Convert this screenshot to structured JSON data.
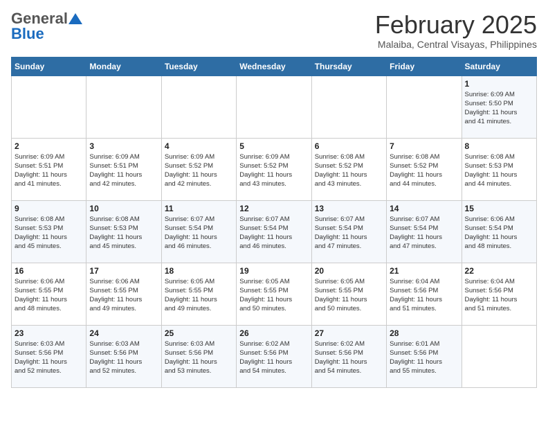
{
  "header": {
    "logo_general": "General",
    "logo_blue": "Blue",
    "month_year": "February 2025",
    "location": "Malaiba, Central Visayas, Philippines"
  },
  "weekdays": [
    "Sunday",
    "Monday",
    "Tuesday",
    "Wednesday",
    "Thursday",
    "Friday",
    "Saturday"
  ],
  "weeks": [
    [
      {
        "day": "",
        "info": ""
      },
      {
        "day": "",
        "info": ""
      },
      {
        "day": "",
        "info": ""
      },
      {
        "day": "",
        "info": ""
      },
      {
        "day": "",
        "info": ""
      },
      {
        "day": "",
        "info": ""
      },
      {
        "day": "1",
        "info": "Sunrise: 6:09 AM\nSunset: 5:50 PM\nDaylight: 11 hours\nand 41 minutes."
      }
    ],
    [
      {
        "day": "2",
        "info": "Sunrise: 6:09 AM\nSunset: 5:51 PM\nDaylight: 11 hours\nand 41 minutes."
      },
      {
        "day": "3",
        "info": "Sunrise: 6:09 AM\nSunset: 5:51 PM\nDaylight: 11 hours\nand 42 minutes."
      },
      {
        "day": "4",
        "info": "Sunrise: 6:09 AM\nSunset: 5:52 PM\nDaylight: 11 hours\nand 42 minutes."
      },
      {
        "day": "5",
        "info": "Sunrise: 6:09 AM\nSunset: 5:52 PM\nDaylight: 11 hours\nand 43 minutes."
      },
      {
        "day": "6",
        "info": "Sunrise: 6:08 AM\nSunset: 5:52 PM\nDaylight: 11 hours\nand 43 minutes."
      },
      {
        "day": "7",
        "info": "Sunrise: 6:08 AM\nSunset: 5:52 PM\nDaylight: 11 hours\nand 44 minutes."
      },
      {
        "day": "8",
        "info": "Sunrise: 6:08 AM\nSunset: 5:53 PM\nDaylight: 11 hours\nand 44 minutes."
      }
    ],
    [
      {
        "day": "9",
        "info": "Sunrise: 6:08 AM\nSunset: 5:53 PM\nDaylight: 11 hours\nand 45 minutes."
      },
      {
        "day": "10",
        "info": "Sunrise: 6:08 AM\nSunset: 5:53 PM\nDaylight: 11 hours\nand 45 minutes."
      },
      {
        "day": "11",
        "info": "Sunrise: 6:07 AM\nSunset: 5:54 PM\nDaylight: 11 hours\nand 46 minutes."
      },
      {
        "day": "12",
        "info": "Sunrise: 6:07 AM\nSunset: 5:54 PM\nDaylight: 11 hours\nand 46 minutes."
      },
      {
        "day": "13",
        "info": "Sunrise: 6:07 AM\nSunset: 5:54 PM\nDaylight: 11 hours\nand 47 minutes."
      },
      {
        "day": "14",
        "info": "Sunrise: 6:07 AM\nSunset: 5:54 PM\nDaylight: 11 hours\nand 47 minutes."
      },
      {
        "day": "15",
        "info": "Sunrise: 6:06 AM\nSunset: 5:54 PM\nDaylight: 11 hours\nand 48 minutes."
      }
    ],
    [
      {
        "day": "16",
        "info": "Sunrise: 6:06 AM\nSunset: 5:55 PM\nDaylight: 11 hours\nand 48 minutes."
      },
      {
        "day": "17",
        "info": "Sunrise: 6:06 AM\nSunset: 5:55 PM\nDaylight: 11 hours\nand 49 minutes."
      },
      {
        "day": "18",
        "info": "Sunrise: 6:05 AM\nSunset: 5:55 PM\nDaylight: 11 hours\nand 49 minutes."
      },
      {
        "day": "19",
        "info": "Sunrise: 6:05 AM\nSunset: 5:55 PM\nDaylight: 11 hours\nand 50 minutes."
      },
      {
        "day": "20",
        "info": "Sunrise: 6:05 AM\nSunset: 5:55 PM\nDaylight: 11 hours\nand 50 minutes."
      },
      {
        "day": "21",
        "info": "Sunrise: 6:04 AM\nSunset: 5:56 PM\nDaylight: 11 hours\nand 51 minutes."
      },
      {
        "day": "22",
        "info": "Sunrise: 6:04 AM\nSunset: 5:56 PM\nDaylight: 11 hours\nand 51 minutes."
      }
    ],
    [
      {
        "day": "23",
        "info": "Sunrise: 6:03 AM\nSunset: 5:56 PM\nDaylight: 11 hours\nand 52 minutes."
      },
      {
        "day": "24",
        "info": "Sunrise: 6:03 AM\nSunset: 5:56 PM\nDaylight: 11 hours\nand 52 minutes."
      },
      {
        "day": "25",
        "info": "Sunrise: 6:03 AM\nSunset: 5:56 PM\nDaylight: 11 hours\nand 53 minutes."
      },
      {
        "day": "26",
        "info": "Sunrise: 6:02 AM\nSunset: 5:56 PM\nDaylight: 11 hours\nand 54 minutes."
      },
      {
        "day": "27",
        "info": "Sunrise: 6:02 AM\nSunset: 5:56 PM\nDaylight: 11 hours\nand 54 minutes."
      },
      {
        "day": "28",
        "info": "Sunrise: 6:01 AM\nSunset: 5:56 PM\nDaylight: 11 hours\nand 55 minutes."
      },
      {
        "day": "",
        "info": ""
      }
    ]
  ]
}
